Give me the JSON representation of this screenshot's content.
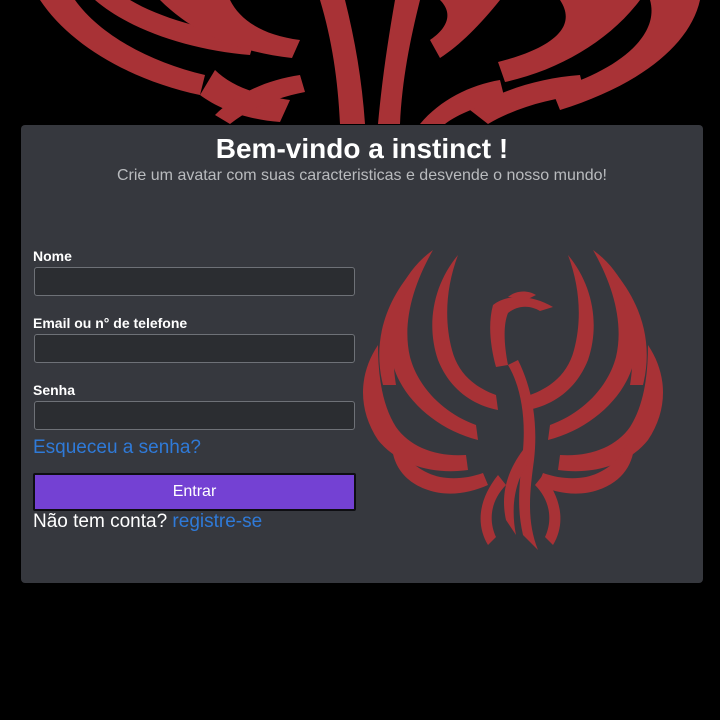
{
  "colors": {
    "accent_red": "#a83236",
    "button_purple": "#7441d3",
    "link_blue": "#2f7ad8",
    "card_bg": "#36383e",
    "page_bg": "#000000"
  },
  "login": {
    "title": "Bem-vindo a instinct !",
    "subtitle": "Crie um avatar com suas caracteristicas e desvende o nosso mundo!",
    "fields": {
      "name_label": "Nome",
      "name_value": "",
      "contact_label": "Email ou n° de telefone",
      "contact_value": "",
      "password_label": "Senha",
      "password_value": ""
    },
    "forgot_link": "Esqueceu a senha?",
    "submit_label": "Entrar",
    "signup_prompt": "Não tem conta?",
    "signup_link": "registre-se"
  },
  "icons": {
    "background_art": "phoenix-wings-icon",
    "card_logo": "phoenix-logo-icon"
  }
}
